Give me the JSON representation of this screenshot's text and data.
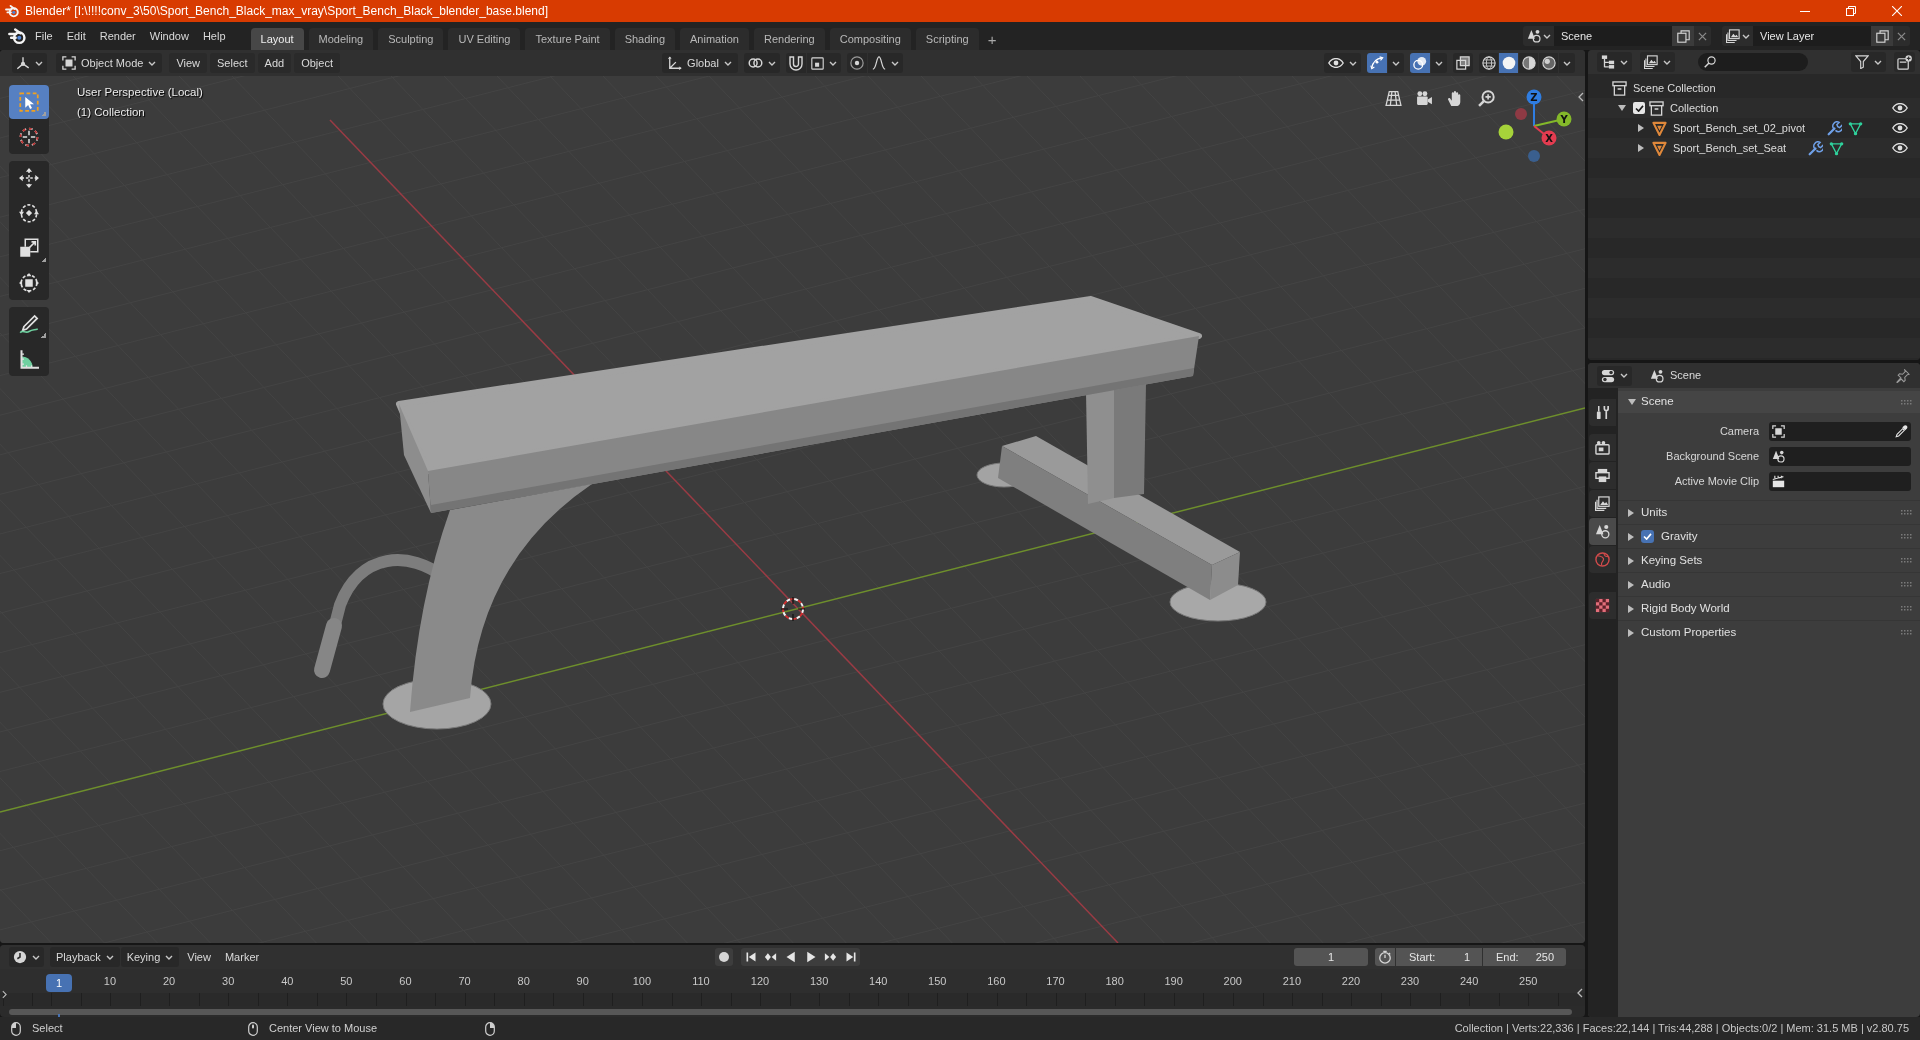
{
  "window": {
    "title": "Blender* [I:\\!!!!conv_3\\50\\Sport_Bench_Black_max_vray\\Sport_Bench_Black_blender_base.blend]"
  },
  "menu": [
    "File",
    "Edit",
    "Render",
    "Window",
    "Help"
  ],
  "workspaces": [
    {
      "label": "Layout",
      "selected": true
    },
    {
      "label": "Modeling",
      "selected": false
    },
    {
      "label": "Sculpting",
      "selected": false
    },
    {
      "label": "UV Editing",
      "selected": false
    },
    {
      "label": "Texture Paint",
      "selected": false
    },
    {
      "label": "Shading",
      "selected": false
    },
    {
      "label": "Animation",
      "selected": false
    },
    {
      "label": "Rendering",
      "selected": false
    },
    {
      "label": "Compositing",
      "selected": false
    },
    {
      "label": "Scripting",
      "selected": false
    }
  ],
  "add_workspace": "+",
  "scene_field": {
    "value": "Scene"
  },
  "view_layer_field": {
    "value": "View Layer"
  },
  "viewport": {
    "header": {
      "mode": "Object Mode",
      "menus": [
        "View",
        "Select",
        "Add",
        "Object"
      ],
      "orientation": "Global",
      "toggles": [
        {
          "kind": "gizmo",
          "on": true
        },
        {
          "kind": "overlay",
          "on": true
        },
        {
          "kind": "xray",
          "on": false
        }
      ],
      "shading": [
        {
          "kind": "wireframe",
          "selected": false
        },
        {
          "kind": "solid",
          "selected": true
        },
        {
          "kind": "material",
          "selected": false
        },
        {
          "kind": "rendered",
          "selected": false
        }
      ]
    },
    "tool_groups": [
      [
        {
          "kind": "select",
          "selected": true,
          "submenu": true
        },
        {
          "kind": "cursor",
          "selected": false,
          "submenu": false
        }
      ],
      [
        {
          "kind": "move",
          "selected": false,
          "submenu": false
        },
        {
          "kind": "rotate",
          "selected": false,
          "submenu": false
        },
        {
          "kind": "scale",
          "selected": false,
          "submenu": true
        },
        {
          "kind": "transform",
          "selected": false,
          "submenu": false
        }
      ],
      [
        {
          "kind": "annotate",
          "selected": false,
          "submenu": true
        },
        {
          "kind": "measure",
          "selected": false,
          "submenu": false
        }
      ]
    ],
    "overlay_text": [
      "User Perspective (Local)",
      "(1) Collection"
    ],
    "gizmo": [
      {
        "kind": "z",
        "label": "Z",
        "color": "#2f7de1"
      },
      {
        "kind": "y",
        "label": "Y",
        "color": "#84b92a"
      },
      {
        "kind": "x",
        "label": "X",
        "color": "#e33c50"
      }
    ]
  },
  "outliner": {
    "tree": [
      {
        "label": "Scene Collection",
        "kind": "scene_collection",
        "children": [
          {
            "label": "Collection",
            "kind": "collection",
            "expanded": true,
            "checked": true,
            "visible": true,
            "children": [
              {
                "label": "Sport_Bench_set_02_pivot",
                "kind": "mesh_object",
                "expanded": false,
                "visible": true
              },
              {
                "label": "Sport_Bench_set_Seat",
                "kind": "mesh_object",
                "expanded": false,
                "visible": true
              }
            ]
          }
        ]
      }
    ]
  },
  "properties": {
    "context": "Scene",
    "tab_groups": [
      [
        {
          "kind": "tool",
          "selected": false
        }
      ],
      [
        {
          "kind": "render",
          "selected": false
        },
        {
          "kind": "output",
          "selected": false
        },
        {
          "kind": "view_layer",
          "selected": false
        },
        {
          "kind": "scene",
          "selected": true
        },
        {
          "kind": "world",
          "selected": false
        }
      ],
      [
        {
          "kind": "texture",
          "selected": false
        }
      ]
    ],
    "panel": {
      "title": "Scene",
      "expanded": true,
      "fields": [
        {
          "label": "Camera",
          "kind": "camera"
        },
        {
          "label": "Background Scene",
          "kind": "scene"
        },
        {
          "label": "Active Movie Clip",
          "kind": "clip"
        }
      ]
    },
    "subpanels": [
      {
        "label": "Units",
        "kind": "plain",
        "expanded": false
      },
      {
        "label": "Gravity",
        "kind": "toggle",
        "checked": true,
        "expanded": false
      },
      {
        "label": "Keying Sets",
        "kind": "plain",
        "expanded": false
      },
      {
        "label": "Audio",
        "kind": "plain",
        "expanded": false
      },
      {
        "label": "Rigid Body World",
        "kind": "plain",
        "expanded": false
      },
      {
        "label": "Custom Properties",
        "kind": "plain",
        "expanded": false
      }
    ]
  },
  "timeline": {
    "menus": [
      {
        "label": "Playback",
        "kind": "dropdown"
      },
      {
        "label": "Keying",
        "kind": "dropdown"
      },
      {
        "label": "View",
        "kind": "menu"
      },
      {
        "label": "Marker",
        "kind": "menu"
      }
    ],
    "record_on": false,
    "current_frame": "1",
    "start_label": "Start:",
    "start": "1",
    "end_label": "End:",
    "end": "250",
    "playhead": "1",
    "ruler": [
      "10",
      "20",
      "30",
      "40",
      "50",
      "60",
      "70",
      "80",
      "90",
      "100",
      "110",
      "120",
      "130",
      "140",
      "150",
      "160",
      "170",
      "180",
      "190",
      "200",
      "210",
      "220",
      "230",
      "240",
      "250"
    ]
  },
  "status_bar": {
    "hints": [
      {
        "kind": "left",
        "label": "Select"
      },
      {
        "kind": "middle",
        "label": "Center View to Mouse"
      },
      {
        "kind": "right"
      }
    ],
    "stats": "Collection | Verts:22,336 | Faces:22,144 | Tris:44,288 | Objects:0/2 | Mem: 31.5 MB | v2.80.75"
  }
}
